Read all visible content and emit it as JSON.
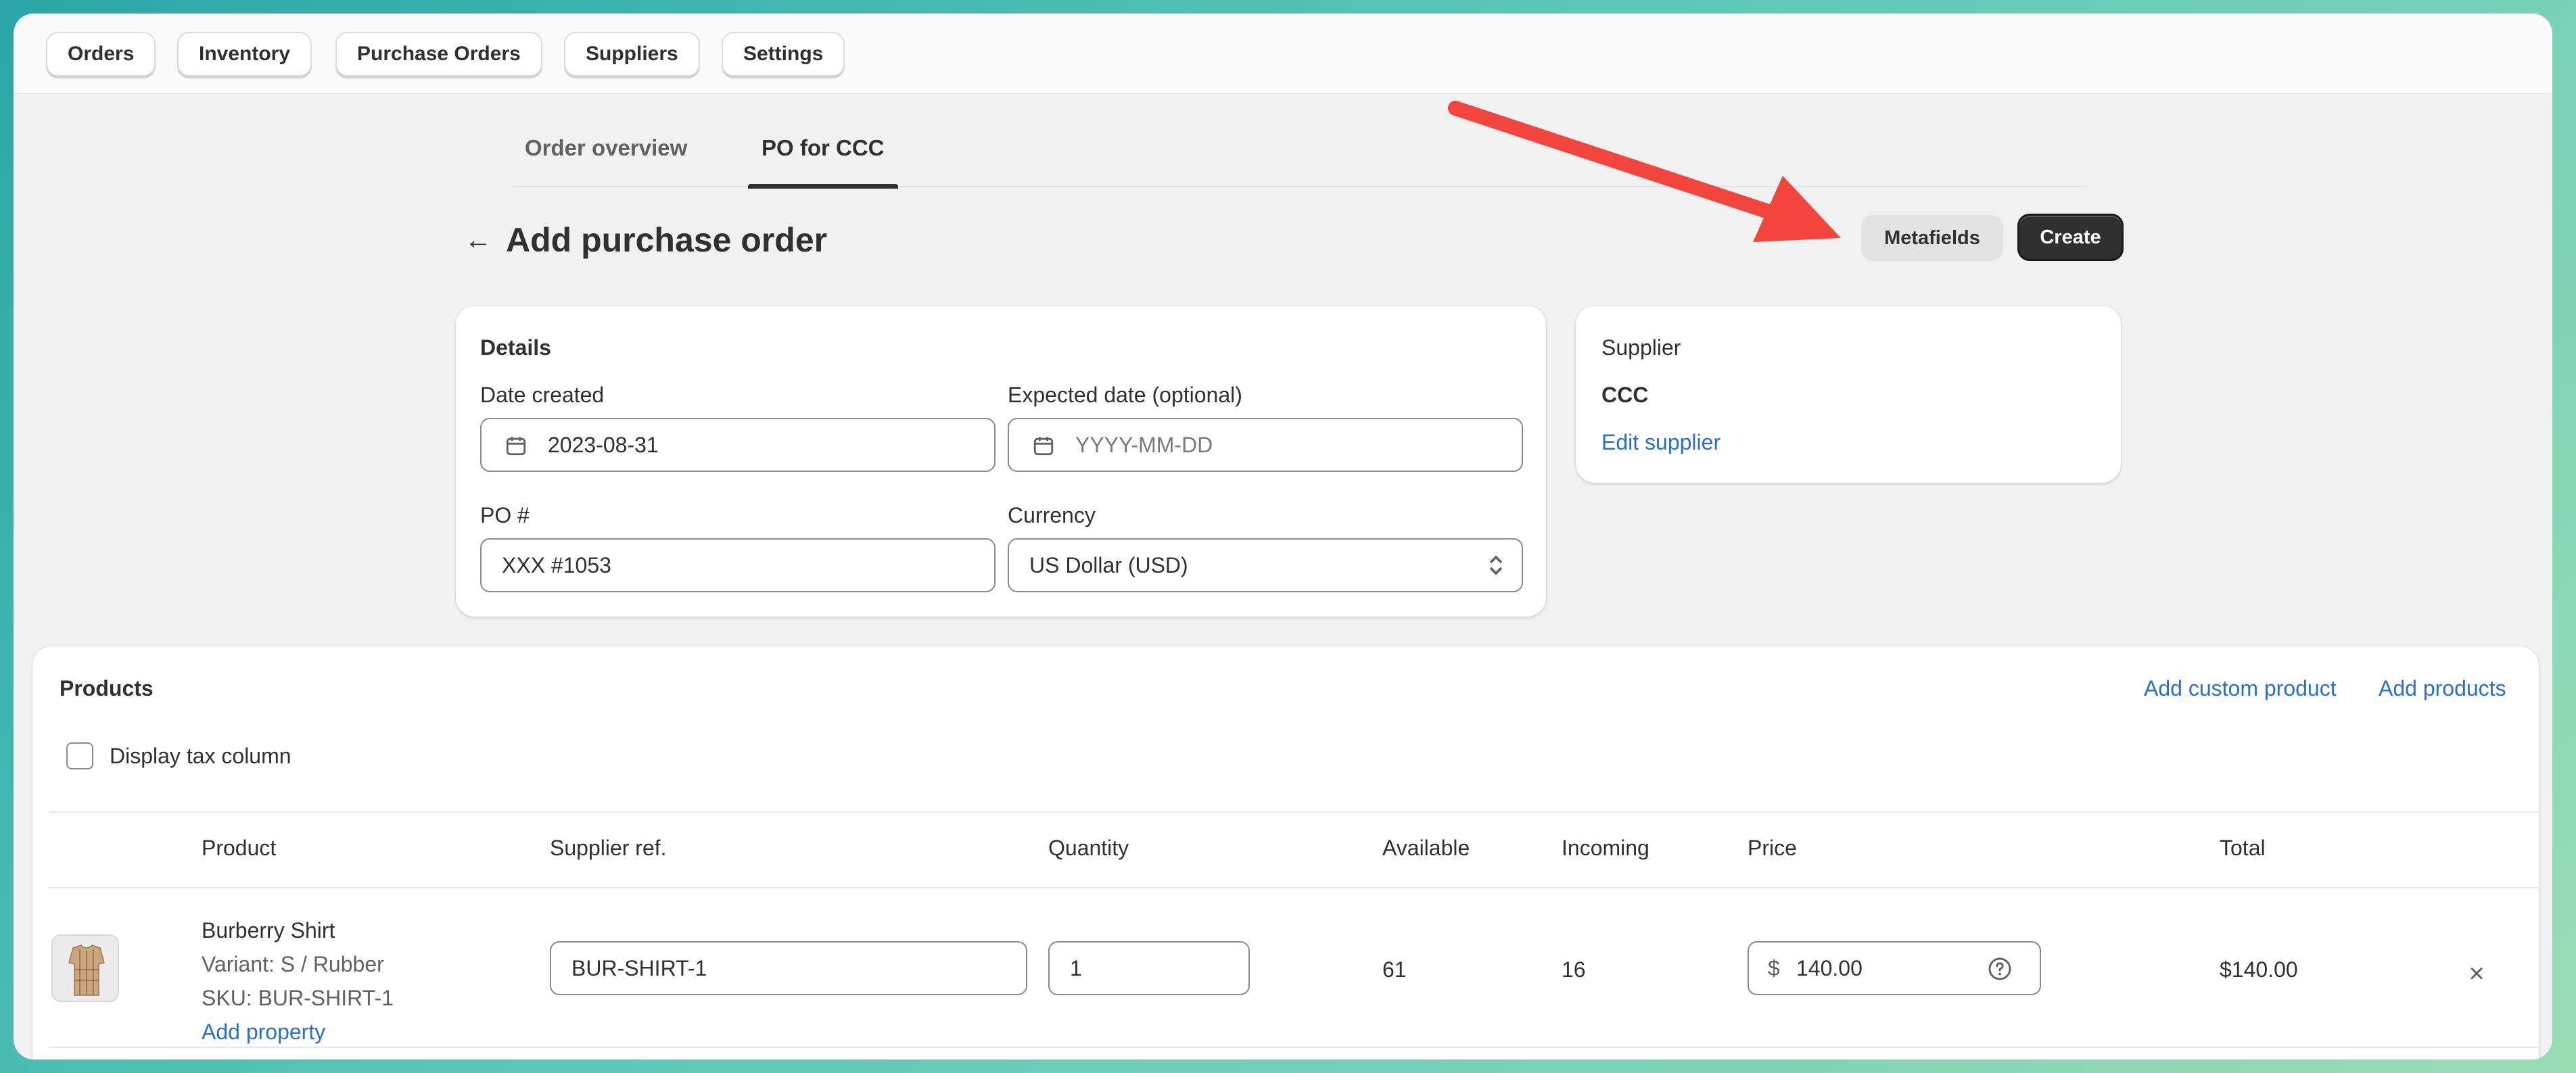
{
  "nav": {
    "items": [
      "Orders",
      "Inventory",
      "Purchase Orders",
      "Suppliers",
      "Settings"
    ]
  },
  "tabs": {
    "overview": "Order overview",
    "po": "PO for CCC"
  },
  "header": {
    "title": "Add purchase order",
    "metafields_label": "Metafields",
    "create_label": "Create"
  },
  "details": {
    "title": "Details",
    "date_created_label": "Date created",
    "date_created_value": "2023-08-31",
    "expected_date_label": "Expected date (optional)",
    "expected_date_placeholder": "YYYY-MM-DD",
    "po_label": "PO #",
    "po_value": "XXX #1053",
    "currency_label": "Currency",
    "currency_value": "US Dollar (USD)"
  },
  "supplier": {
    "title": "Supplier",
    "name": "CCC",
    "edit_link": "Edit supplier"
  },
  "products": {
    "title": "Products",
    "add_custom_link": "Add custom product",
    "add_products_link": "Add products",
    "tax_checkbox_label": "Display tax column",
    "tax_checkbox_checked": false,
    "columns": [
      "Product",
      "Supplier ref.",
      "Quantity",
      "Available",
      "Incoming",
      "Price",
      "Total"
    ],
    "rows": [
      {
        "name": "Burberry Shirt",
        "variant": "Variant: S / Rubber",
        "sku": "SKU: BUR-SHIRT-1",
        "add_property": "Add property",
        "supplier_ref": "BUR-SHIRT-1",
        "quantity": "1",
        "available": "61",
        "incoming": "16",
        "currency_symbol": "$",
        "price": "140.00",
        "total": "$140.00"
      }
    ]
  },
  "colors": {
    "accent_link": "#2c6ecb",
    "primary_button": "#303030",
    "annotation_arrow": "#f2453d"
  }
}
